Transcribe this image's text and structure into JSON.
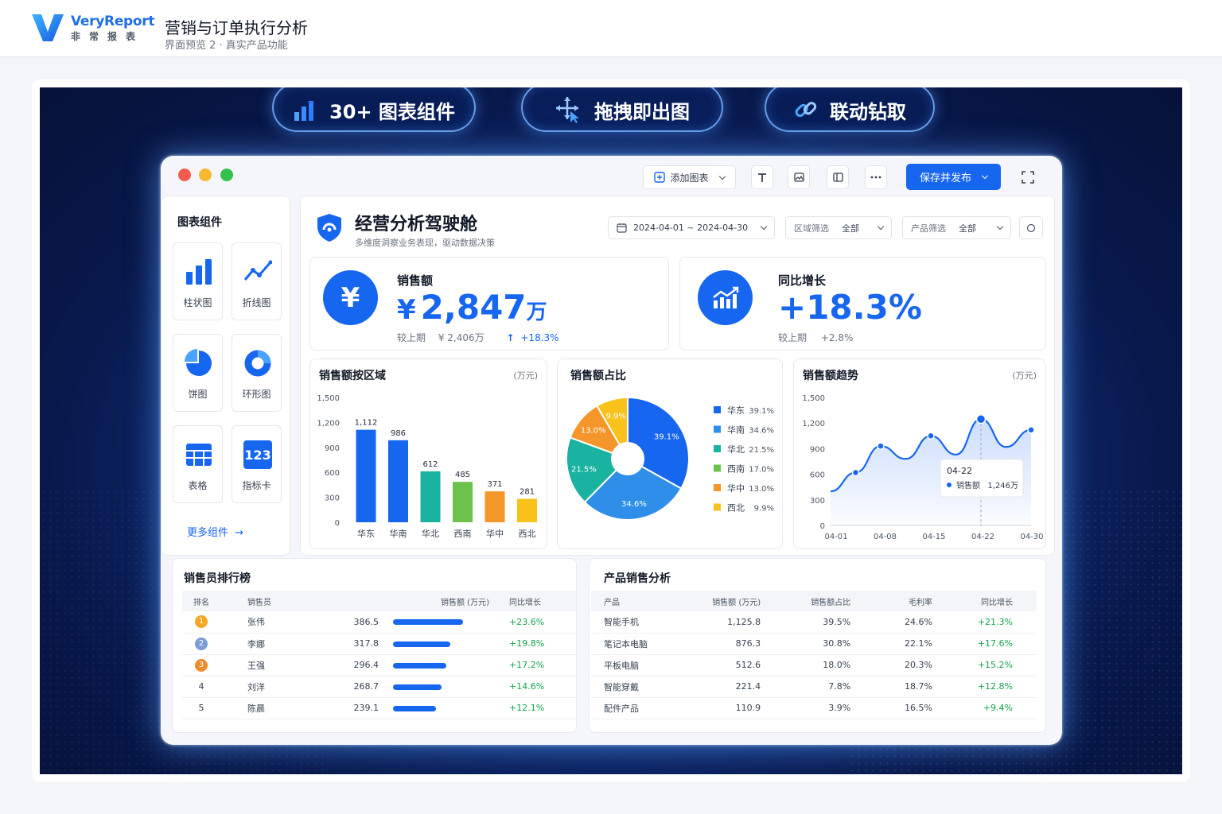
{
  "brand": {
    "name": "VeryReport",
    "sub": "非常报表"
  },
  "header": {
    "title": "营销与订单执行分析",
    "subtitle": "界面预览 2 · 真实产品功能"
  },
  "pills": [
    "30+ 图表组件",
    "拖拽即出图",
    "联动钻取"
  ],
  "toolbar": {
    "add_chart": "添加图表",
    "save_publish": "保存并发布"
  },
  "library": {
    "title": "图表组件",
    "items": [
      "柱状图",
      "折线图",
      "饼图",
      "环形图",
      "表格",
      "指标卡"
    ],
    "metric_icon_text": "123",
    "more": "更多组件"
  },
  "dashboard": {
    "title": "经营分析驾驶舱",
    "subtitle": "多维度洞察业务表现，驱动数据决策",
    "date_range": "2024-04-01 ~ 2024-04-30",
    "region_filter": {
      "label": "区域筛选",
      "value": "全部"
    },
    "product_filter": {
      "label": "产品筛选",
      "value": "全部"
    }
  },
  "kpis": {
    "sales": {
      "title": "销售额",
      "prefix": "¥",
      "value": "2,847",
      "unit": "万",
      "compare_label": "较上期",
      "compare_value": "¥ 2,406万",
      "change": "+18.3%",
      "icon": "¥"
    },
    "growth": {
      "title": "同比增长",
      "value": "+18.3%",
      "compare_label": "较上期",
      "compare_value": "+2.8%"
    }
  },
  "colors": {
    "accent": "#1766f0",
    "green": "#10a34a"
  },
  "chart_data": [
    {
      "type": "bar",
      "title": "销售额按区域",
      "unit": "(万元)",
      "categories": [
        "华东",
        "华南",
        "华北",
        "西南",
        "华中",
        "西北"
      ],
      "values": [
        1112,
        986,
        612,
        485,
        371,
        281
      ],
      "labels": [
        "1,112",
        "986",
        "612",
        "485",
        "371",
        "281"
      ],
      "ylim": [
        0,
        1500
      ],
      "yticks": [
        "0",
        "300",
        "600",
        "900",
        "1,200",
        "1,500"
      ],
      "colors": [
        "#1766f0",
        "#1766f0",
        "#19b3a0",
        "#6cc24a",
        "#f5962a",
        "#f8c21a"
      ],
      "grid": false
    },
    {
      "type": "pie",
      "title": "销售额占比",
      "categories": [
        "华东",
        "华南",
        "华北",
        "西南",
        "华中",
        "西北"
      ],
      "values": [
        39.1,
        34.6,
        21.5,
        17.0,
        13.0,
        9.9
      ],
      "legend_values": [
        "39.1%",
        "34.6%",
        "21.5%",
        "17.0%",
        "13.0%",
        "9.9%"
      ],
      "slices": [
        {
          "name": "华东",
          "value": 39.1,
          "label": "39.1%",
          "color": "#1766f0"
        },
        {
          "name": "华南",
          "value": 34.6,
          "label": "34.6%",
          "color": "#2f8fe8"
        },
        {
          "name": "华北",
          "value": 21.5,
          "label": "21.5%",
          "color": "#19b3a0"
        },
        {
          "name": "华中",
          "value": 13.0,
          "label": "13.0%",
          "color": "#f5962a"
        },
        {
          "name": "西北",
          "value": 9.9,
          "label": "9.9%",
          "color": "#f8c21a"
        }
      ],
      "legend_colors": [
        "#1766f0",
        "#2f8fe8",
        "#19b3a0",
        "#6cc24a",
        "#f5962a",
        "#f8c21a"
      ],
      "legend_position": "right"
    },
    {
      "type": "area",
      "title": "销售额趋势",
      "unit": "(万元)",
      "x": [
        "04-01",
        "04-04",
        "04-08",
        "04-12",
        "04-15",
        "04-18",
        "04-22",
        "04-26",
        "04-30"
      ],
      "values": [
        400,
        620,
        930,
        780,
        1050,
        830,
        1246,
        920,
        1120
      ],
      "markers": [
        1,
        2,
        4,
        6,
        8
      ],
      "xticks": [
        "04-01",
        "04-08",
        "04-15",
        "04-22",
        "04-30"
      ],
      "ylim": [
        0,
        1500
      ],
      "yticks": [
        "0",
        "300",
        "600",
        "900",
        "1,200",
        "1,500"
      ],
      "tooltip": {
        "date": "04-22",
        "series": "销售额",
        "value": "1,246万",
        "index": 6
      }
    }
  ],
  "rank_table": {
    "title": "销售员排行榜",
    "headers": [
      "排名",
      "销售员",
      "销售额 (万元)",
      "同比增长"
    ],
    "rows": [
      {
        "rank": "1",
        "name": "张伟",
        "sales": "386.5",
        "value": 386.5,
        "growth": "+23.6%",
        "medal": "#f5a623"
      },
      {
        "rank": "2",
        "name": "李娜",
        "sales": "317.8",
        "value": 317.8,
        "growth": "+19.8%",
        "medal": "#7a9cd9"
      },
      {
        "rank": "3",
        "name": "王强",
        "sales": "296.4",
        "value": 296.4,
        "growth": "+17.2%",
        "medal": "#f08a2b"
      },
      {
        "rank": "4",
        "name": "刘洋",
        "sales": "268.7",
        "value": 268.7,
        "growth": "+14.6%",
        "medal": ""
      },
      {
        "rank": "5",
        "name": "陈晨",
        "sales": "239.1",
        "value": 239.1,
        "growth": "+12.1%",
        "medal": ""
      }
    ]
  },
  "product_table": {
    "title": "产品销售分析",
    "headers": [
      "产品",
      "销售额 (万元)",
      "销售额占比",
      "毛利率",
      "同比增长"
    ],
    "rows": [
      [
        "智能手机",
        "1,125.8",
        "39.5%",
        "24.6%",
        "+21.3%"
      ],
      [
        "笔记本电脑",
        "876.3",
        "30.8%",
        "22.1%",
        "+17.6%"
      ],
      [
        "平板电脑",
        "512.6",
        "18.0%",
        "20.3%",
        "+15.2%"
      ],
      [
        "智能穿戴",
        "221.4",
        "7.8%",
        "18.7%",
        "+12.8%"
      ],
      [
        "配件产品",
        "110.9",
        "3.9%",
        "16.5%",
        "+9.4%"
      ]
    ]
  }
}
